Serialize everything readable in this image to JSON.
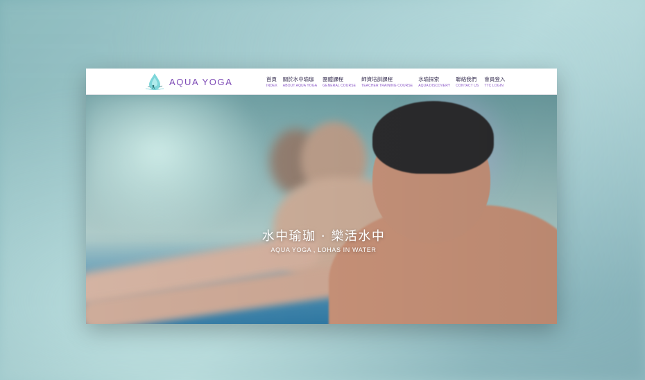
{
  "brand": {
    "name": "AQUA YOGA",
    "logo_icon": "water-drop-yoga-icon",
    "accent_color": "#7e4bb6"
  },
  "nav": {
    "items": [
      {
        "zh": "首頁",
        "en": "INDEX"
      },
      {
        "zh": "關於水中瑜珈",
        "en": "ABOUT AQUA YOGA"
      },
      {
        "zh": "團體課程",
        "en": "GENERAL COURSE"
      },
      {
        "zh": "師資培訓課程",
        "en": "TEACHER TRAINING COURSE"
      },
      {
        "zh": "水瑜探索",
        "en": "AQUA DISCOVERY"
      },
      {
        "zh": "聯絡我們",
        "en": "CONTACT US"
      },
      {
        "zh": "會員登入",
        "en": "TTC LOGIN"
      }
    ]
  },
  "hero": {
    "title_zh": "水中瑜珈 · 樂活水中",
    "title_en": "AQUA YOGA , LOHAS IN WATER"
  }
}
